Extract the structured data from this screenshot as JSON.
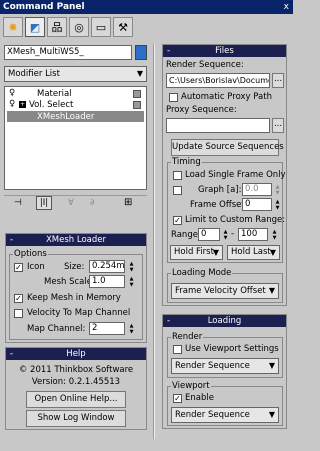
{
  "window": {
    "title": "Command Panel",
    "close": "x"
  },
  "tabs": [
    {
      "icon": "create-icon",
      "glyph": "✸"
    },
    {
      "icon": "modify-icon",
      "glyph": "◩"
    },
    {
      "icon": "hierarchy-icon",
      "glyph": "品"
    },
    {
      "icon": "motion-icon",
      "glyph": "◎"
    },
    {
      "icon": "display-icon",
      "glyph": "▭"
    },
    {
      "icon": "utilities-icon",
      "glyph": "⚒"
    }
  ],
  "object_name": "XMesh_MultiWS5_",
  "object_color": "#2a6fc9",
  "modifier_list": "Modifier List",
  "stack": {
    "items": [
      {
        "label": "Material"
      },
      {
        "label": "Vol. Select"
      },
      {
        "label": "XMeshLoader"
      }
    ]
  },
  "stack_tools": {
    "pin": "⊣",
    "show_end": "|I|",
    "unique": "∀",
    "remove": "∂",
    "config": "⊞"
  },
  "xmesh_loader": {
    "title": "XMesh Loader",
    "options_label": "Options",
    "icon_label": "Icon",
    "size_label": "Size:",
    "size_value": "0.254m",
    "mesh_scale_label": "Mesh Scale:",
    "mesh_scale_value": "1.0",
    "keep_mesh_label": "Keep Mesh in Memory",
    "velocity_label": "Velocity To Map Channel",
    "map_channel_label": "Map Channel:",
    "map_channel_value": "2"
  },
  "help": {
    "title": "Help",
    "copyright": "© 2011 Thinkbox Software",
    "version": "Version: 0.2.1.45513",
    "open_help": "Open Online Help...",
    "show_log": "Show Log Window"
  },
  "files": {
    "title": "Files",
    "render_sequence_label": "Render Sequence:",
    "render_sequence_value": "C:\\Users\\Borislav\\Documen",
    "browse": "...",
    "auto_proxy_label": "Automatic Proxy Path",
    "proxy_sequence_label": "Proxy Sequence:",
    "proxy_sequence_value": "",
    "update_sources": "Update Source Sequences",
    "timing_label": "Timing",
    "load_single_label": "Load Single Frame Only",
    "graph_label": "Graph [a]:",
    "graph_value": "0.0",
    "frame_offset_label": "Frame Offset:",
    "frame_offset_value": "0",
    "limit_range_label": "Limit to Custom Range:",
    "range_label": "Range",
    "range_start": "0",
    "range_end": "100",
    "hold_first": "Hold First",
    "hold_last": "Hold Last",
    "loading_mode_label": "Loading Mode",
    "loading_mode_value": "Frame Velocity Offset"
  },
  "loading": {
    "title": "Loading",
    "render_label": "Render",
    "use_viewport_label": "Use Viewport Settings",
    "render_mode": "Render Sequence",
    "viewport_label": "Viewport",
    "enable_label": "Enable",
    "viewport_mode": "Render Sequence"
  },
  "rollout_minus": "-",
  "check": "✓",
  "arrow": "▼"
}
